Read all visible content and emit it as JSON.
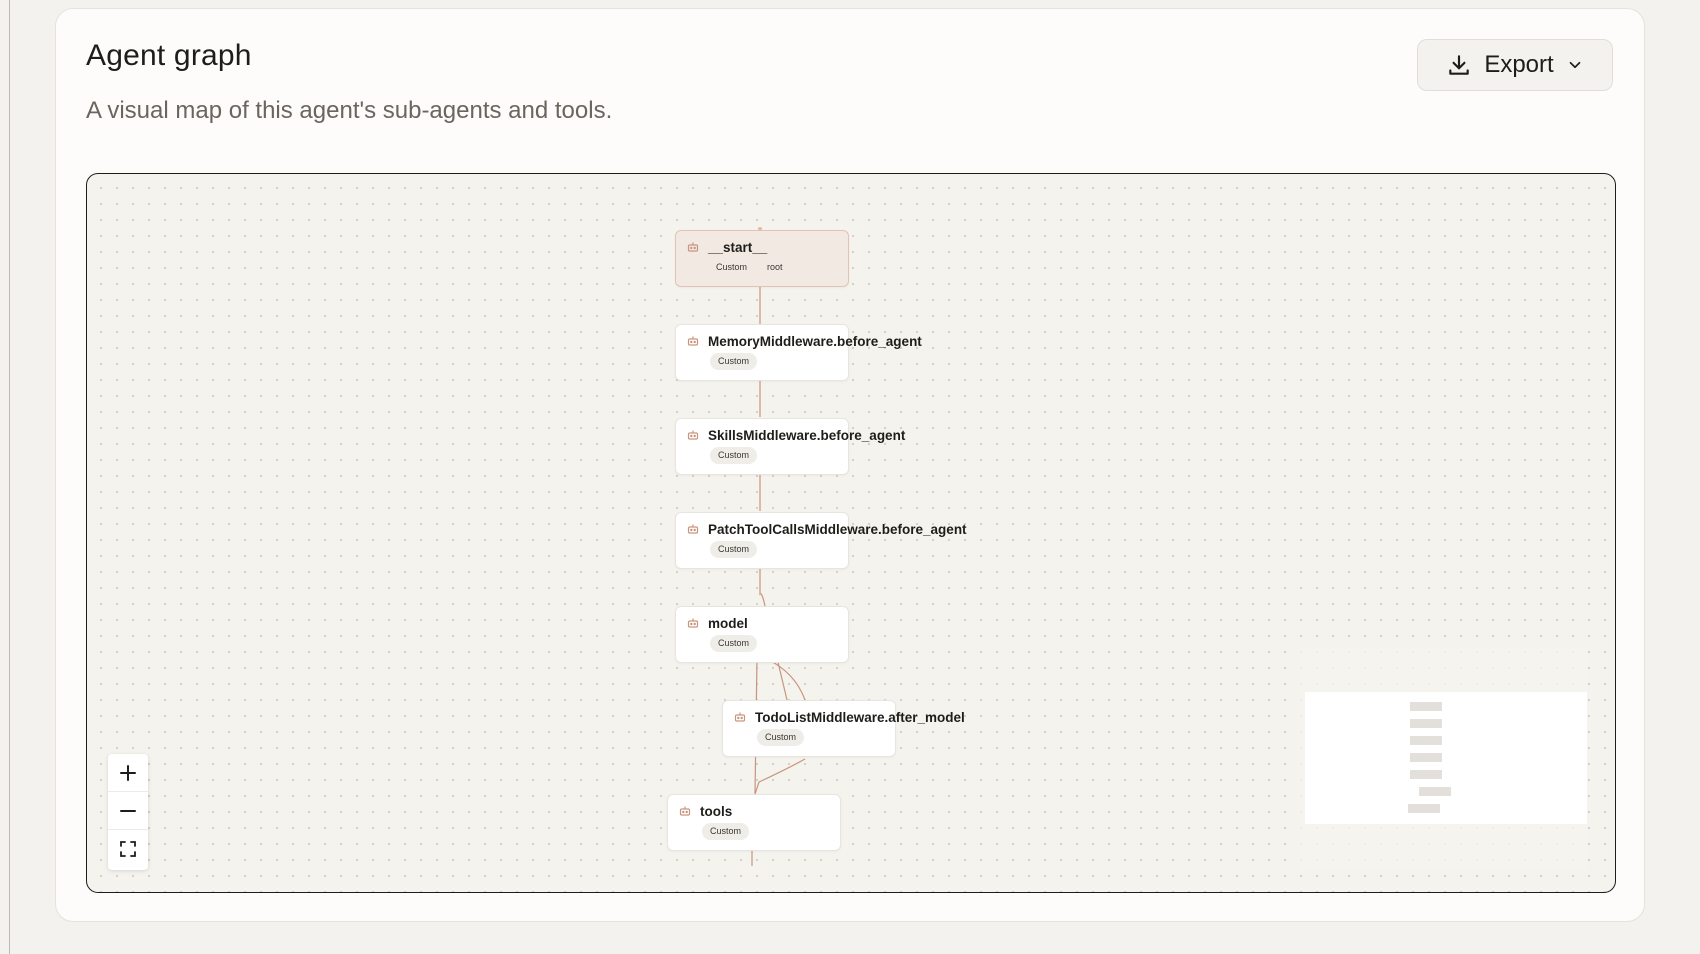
{
  "card": {
    "title": "Agent graph",
    "subtitle": "A visual map of this agent's sub-agents and tools."
  },
  "export_button": {
    "label": "Export",
    "icon": "download-icon",
    "dropdown_icon": "chevron-down-icon"
  },
  "graph": {
    "edge_color": "#c9947e",
    "nodes": [
      {
        "id": "start",
        "title": "__start__",
        "badge": "Custom",
        "badge2": "root",
        "icon": "agent-icon"
      },
      {
        "id": "memory",
        "title": "MemoryMiddleware.before_agent",
        "badge": "Custom",
        "icon": "agent-icon"
      },
      {
        "id": "skills",
        "title": "SkillsMiddleware.before_agent",
        "badge": "Custom",
        "icon": "agent-icon"
      },
      {
        "id": "patch",
        "title": "PatchToolCallsMiddleware.before_agent",
        "badge": "Custom",
        "icon": "agent-icon"
      },
      {
        "id": "model",
        "title": "model",
        "badge": "Custom",
        "icon": "agent-icon"
      },
      {
        "id": "todo",
        "title": "TodoListMiddleware.after_model",
        "badge": "Custom",
        "icon": "agent-icon"
      },
      {
        "id": "tools",
        "title": "tools",
        "badge": "Custom",
        "icon": "agent-icon"
      }
    ]
  },
  "controls": {
    "zoom_in_icon": "plus-icon",
    "zoom_out_icon": "minus-icon",
    "fit_view_icon": "fullscreen-icon"
  }
}
